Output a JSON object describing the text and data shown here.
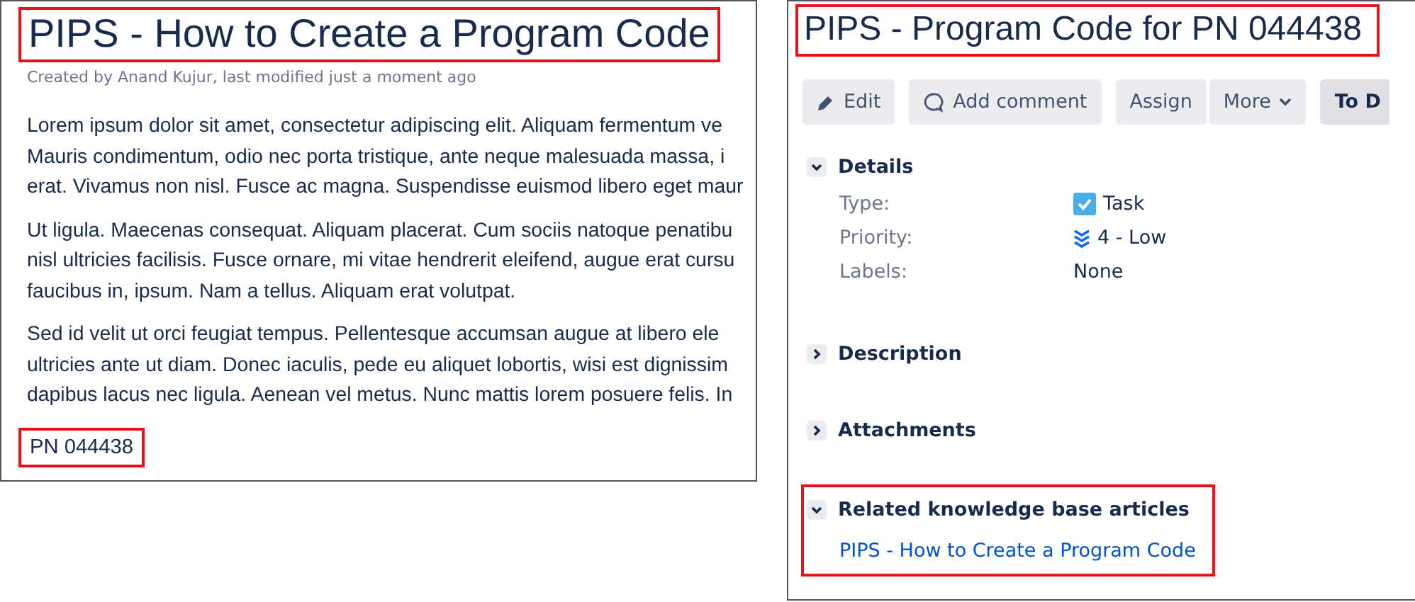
{
  "article": {
    "title": "PIPS - How to Create a Program Code",
    "title_highlighted": true,
    "byline": "Created by Anand Kujur, last modified just a moment ago",
    "paragraphs": [
      [
        "Lorem ipsum dolor sit amet, consectetur adipiscing elit. Aliquam fermentum ve",
        "Mauris condimentum, odio nec porta tristique, ante neque malesuada massa, i",
        "erat. Vivamus non nisl. Fusce ac magna. Suspendisse euismod libero eget maur"
      ],
      [
        "Ut ligula. Maecenas consequat. Aliquam placerat. Cum sociis natoque penatibu",
        "nisl ultricies facilisis. Fusce ornare, mi vitae hendrerit eleifend, augue erat cursu",
        "faucibus in, ipsum. Nam a tellus. Aliquam erat volutpat."
      ],
      [
        "Sed id velit ut orci feugiat tempus. Pellentesque accumsan augue at libero ele",
        "ultricies ante ut diam. Donec iaculis, pede eu aliquet lobortis, wisi est dignissim",
        "dapibus lacus nec ligula. Aenean vel metus. Nunc mattis lorem posuere felis. In"
      ]
    ],
    "part_number": "PN 044438",
    "part_number_highlighted": true
  },
  "issue": {
    "title": "PIPS - Program Code for PN 044438",
    "title_highlighted": true,
    "toolbar": [
      {
        "label": "Edit",
        "kind": "edit"
      },
      {
        "label": "Add comment",
        "kind": "comment"
      },
      {
        "label": "Assign",
        "kind": "plain"
      },
      {
        "label": "More",
        "kind": "dropdown"
      },
      {
        "label": "To D",
        "kind": "status"
      }
    ],
    "sections": [
      {
        "title": "Details",
        "expanded": true,
        "highlighted": false,
        "fields": [
          {
            "label": "Type:",
            "value": "Task",
            "kind": "task"
          },
          {
            "label": "Priority:",
            "value": "4 - Low",
            "kind": "priority"
          },
          {
            "label": "Labels:",
            "value": "None",
            "kind": "plain"
          }
        ]
      },
      {
        "title": "Description",
        "expanded": false,
        "highlighted": false
      },
      {
        "title": "Attachments",
        "expanded": false,
        "highlighted": false
      },
      {
        "title": "Related knowledge base articles",
        "expanded": true,
        "highlighted": true,
        "links": [
          "PIPS - How to Create a Program Code"
        ]
      }
    ]
  }
}
